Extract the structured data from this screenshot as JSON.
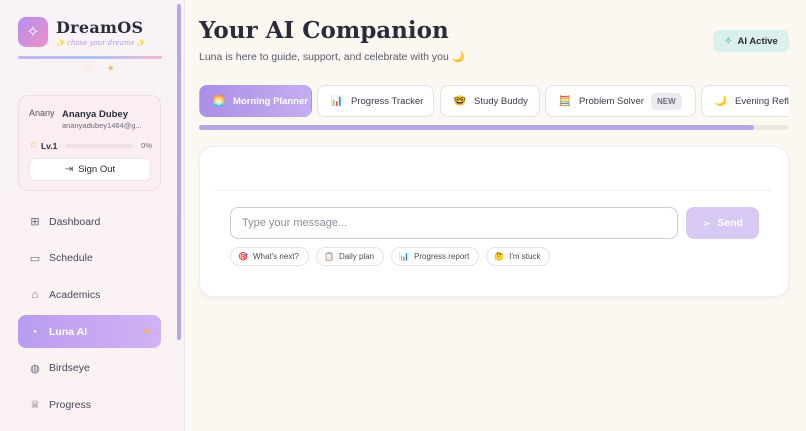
{
  "brand": {
    "name": "DreamOS",
    "tagline": "✨ chase your dreams ✨",
    "logo_icon": "sparkle-icon",
    "deco": "♡ ★"
  },
  "user": {
    "avatar_alt": "Ananya",
    "name": "Ananya Dubey",
    "email": "ananyadubey1464@g...",
    "level_label": "Lv.1",
    "level_progress_pct": 0,
    "level_pct_text": "0%",
    "signout_label": "Sign Out"
  },
  "nav": {
    "items": [
      {
        "label": "Dashboard",
        "icon": "grid-icon",
        "active": false
      },
      {
        "label": "Schedule",
        "icon": "calendar-icon",
        "active": false
      },
      {
        "label": "Academics",
        "icon": "graduation-cap-icon",
        "active": false
      },
      {
        "label": "Luna AI",
        "icon": "dot-icon",
        "active": true
      },
      {
        "label": "Birdseye",
        "icon": "globe-icon",
        "active": false
      },
      {
        "label": "Progress",
        "icon": "trophy-icon",
        "active": false
      }
    ]
  },
  "header": {
    "title": "Your AI Companion",
    "subtitle": "Luna is here to guide, support, and celebrate with you 🌙",
    "status_badge": "AI Active"
  },
  "tabs": [
    {
      "label": "Morning Planner",
      "icon": "🌅",
      "active": true
    },
    {
      "label": "Progress Tracker",
      "icon": "📊",
      "active": false
    },
    {
      "label": "Study Buddy",
      "icon": "🤓",
      "active": false
    },
    {
      "label": "Problem Solver",
      "icon": "🧮",
      "active": false,
      "badge": "NEW"
    },
    {
      "label": "Evening Refle",
      "icon": "🌙",
      "active": false
    }
  ],
  "tabs_scroll_fraction": 0.94,
  "chat": {
    "input_placeholder": "Type your message...",
    "input_value": "",
    "send_label": "Send",
    "chips": [
      {
        "label": "What's next?",
        "icon": "🎯"
      },
      {
        "label": "Daily plan",
        "icon": "📋"
      },
      {
        "label": "Progress report",
        "icon": "📊"
      },
      {
        "label": "I'm stuck",
        "icon": "🤔"
      }
    ]
  },
  "colors": {
    "accent": "#b99cf0",
    "badge_bg": "#d9f0ec",
    "send_bg": "#d7c9f4"
  }
}
